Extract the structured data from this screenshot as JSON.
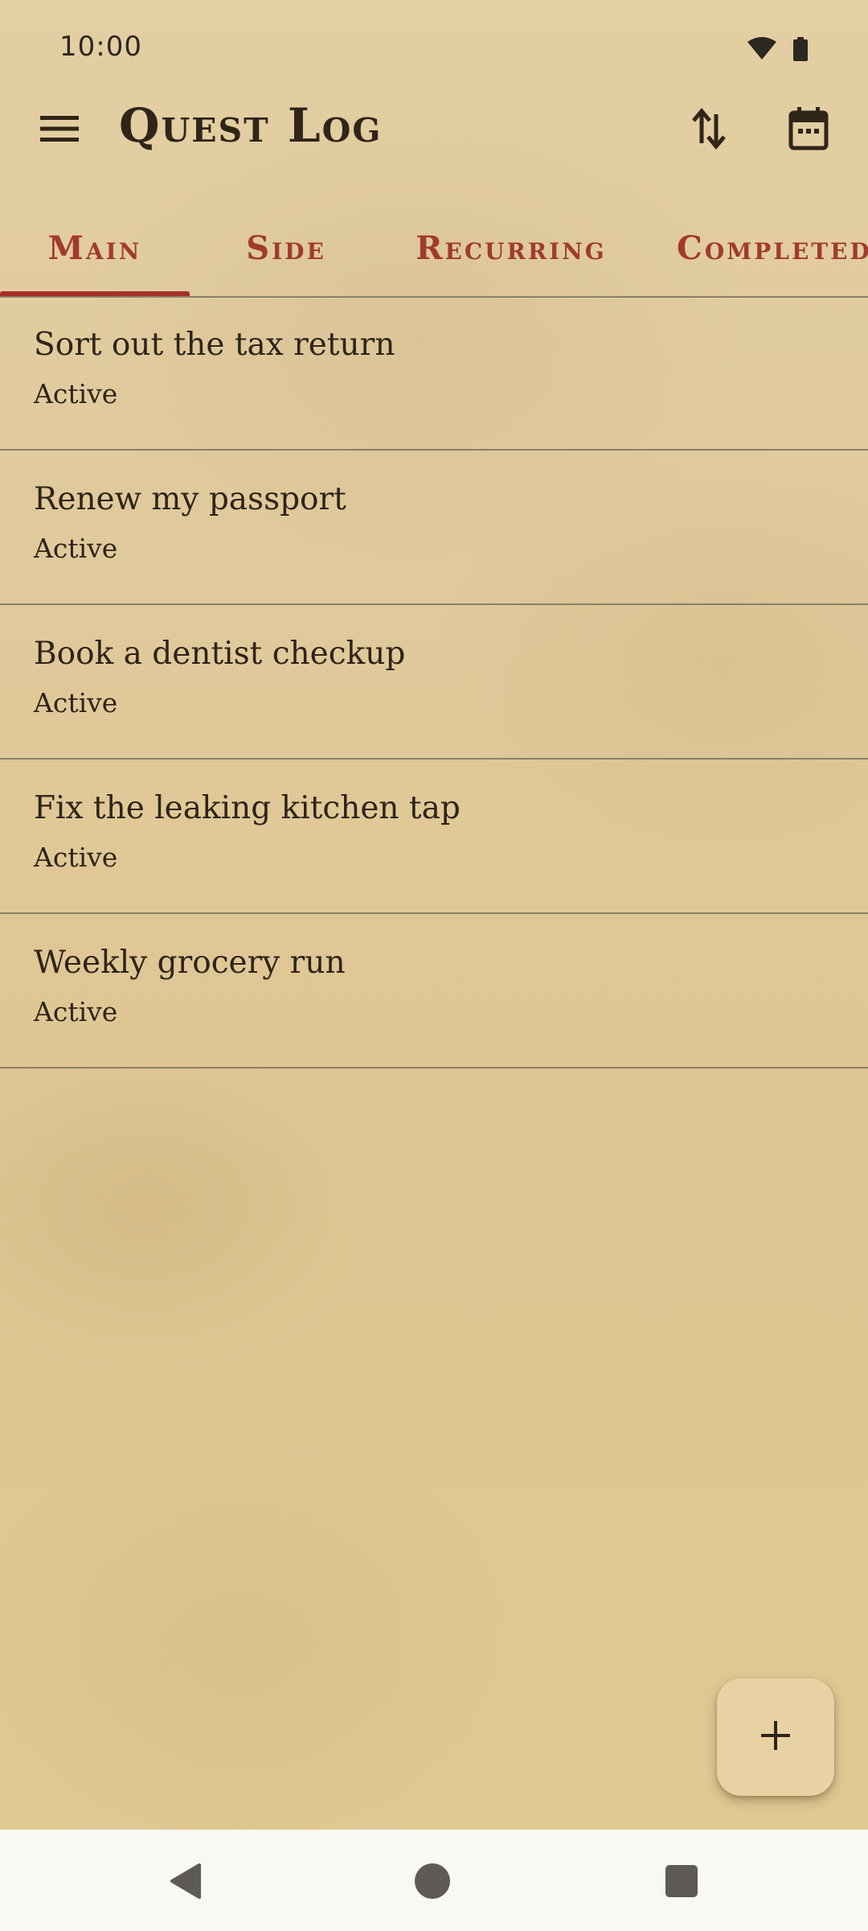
{
  "status_bar": {
    "time": "10:00",
    "icons": [
      "wifi-icon",
      "battery-icon"
    ]
  },
  "app_bar": {
    "title": "Quest Log",
    "icons": [
      "menu-icon",
      "sort-icon",
      "calendar-icon"
    ]
  },
  "tabs": [
    {
      "label": "Main",
      "selected": true
    },
    {
      "label": "Side",
      "selected": false
    },
    {
      "label": "Recurring",
      "selected": false
    },
    {
      "label": "Completed",
      "selected": false
    }
  ],
  "quests": [
    {
      "title": "Sort out the tax return",
      "status": "Active"
    },
    {
      "title": "Renew my passport",
      "status": "Active"
    },
    {
      "title": "Book a dentist checkup",
      "status": "Active"
    },
    {
      "title": "Fix the leaking kitchen tap",
      "status": "Active"
    },
    {
      "title": "Weekly grocery run",
      "status": "Active"
    }
  ],
  "fab": {
    "icon": "plus-icon"
  },
  "nav_bar": {
    "icons": [
      "back-icon",
      "home-icon",
      "recents-icon"
    ]
  },
  "colors": {
    "accent": "#a4302a",
    "background": "#e0c99b",
    "text": "#2e2418",
    "divider": "#8d7f68",
    "nav_background": "#faf8f3"
  }
}
